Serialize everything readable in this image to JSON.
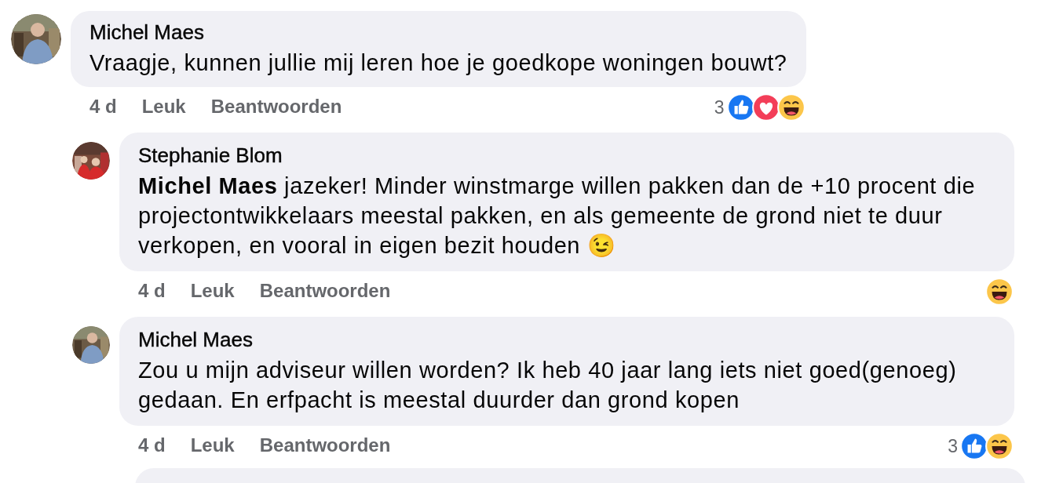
{
  "comments": [
    {
      "author": "Michel Maes",
      "avatar": {
        "kind": "picture"
      },
      "text": "Vraagje, kunnen jullie mij leren hoe je goedkope woningen bouwt?",
      "time": "4 d",
      "actions": [
        "Leuk",
        "Beantwoorden"
      ],
      "reaction_count": "3",
      "reactions": [
        {
          "kind": "like"
        },
        {
          "kind": "love"
        },
        {
          "kind": "haha"
        }
      ],
      "replies": [
        {
          "author": "Stephanie Blom",
          "avatar": {
            "kind": "picture"
          },
          "text": "**Michel Maes** jazeker! Minder winstmarge willen pakken dan de +10 procent die projectontwikkelaars meestal pakken, en als gemeente de grond niet te duur verkopen, en vooral in eigen bezit houden 😉",
          "time": "4 d",
          "actions": [
            "Leuk",
            "Beantwoorden"
          ],
          "reactions": [
            {
              "kind": "haha"
            }
          ]
        },
        {
          "author": "Michel Maes",
          "avatar": {
            "kind": "picture"
          },
          "text": "Zou u mijn adviseur willen worden? Ik heb 40 jaar lang iets niet goed(genoeg) gedaan. En erfpacht is meestal duurder dan grond kopen",
          "time": "4 d",
          "actions": [
            "Leuk",
            "Beantwoorden"
          ],
          "reaction_count": "3",
          "reactions": [
            {
              "kind": "like"
            },
            {
              "kind": "haha"
            }
          ]
        }
      ]
    }
  ]
}
